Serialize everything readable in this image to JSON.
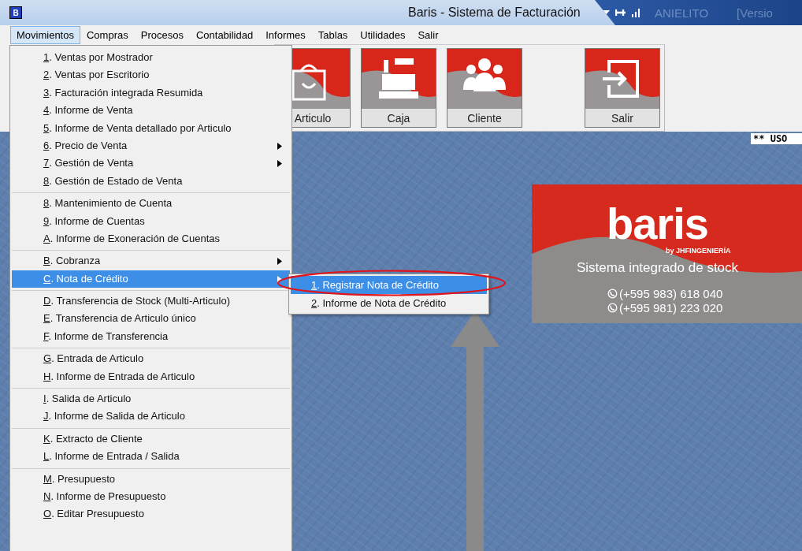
{
  "window": {
    "title": "Baris - Sistema de Facturación",
    "app_icon": "B",
    "status_texts": [
      "ANIELITO",
      "[Versio"
    ]
  },
  "menu_bar": [
    {
      "label": "Movimientos",
      "selected": true
    },
    {
      "label": "Compras",
      "selected": false
    },
    {
      "label": "Procesos",
      "selected": false
    },
    {
      "label": "Contabilidad",
      "selected": false
    },
    {
      "label": "Informes",
      "selected": false
    },
    {
      "label": "Tablas",
      "selected": false
    },
    {
      "label": "Utilidades",
      "selected": false
    },
    {
      "label": "Salir",
      "selected": false
    }
  ],
  "toolbar": [
    {
      "label": "Articulo",
      "kind": "bag"
    },
    {
      "label": "Caja",
      "kind": "register"
    },
    {
      "label": "Cliente",
      "kind": "people"
    },
    {
      "label": "Salir",
      "kind": "exit"
    }
  ],
  "desktop": {
    "notice": "** USO",
    "banner": {
      "logo": "baris",
      "byline": "by JHFINGENIERÍA",
      "tagline": "Sistema integrado de stock",
      "phones": [
        "(+595 983) 618 040",
        "(+595 981) 223 020"
      ]
    }
  },
  "dropdown": {
    "groups": [
      {
        "items": [
          {
            "label": "1. Ventas por Mostrador",
            "submenu": false,
            "selected": false
          },
          {
            "label": "2. Ventas por Escritorio",
            "submenu": false,
            "selected": false
          },
          {
            "label": "3. Facturación integrada Resumida",
            "submenu": false,
            "selected": false
          },
          {
            "label": "4. Informe de Venta",
            "submenu": false,
            "selected": false
          },
          {
            "label": "5. Informe de Venta detallado por Articulo",
            "submenu": false,
            "selected": false
          },
          {
            "label": "6. Precio de Venta",
            "submenu": true,
            "selected": false
          },
          {
            "label": "7. Gestión de Venta",
            "submenu": true,
            "selected": false
          },
          {
            "label": "8. Gestión de Estado de Venta",
            "submenu": false,
            "selected": false
          }
        ]
      },
      {
        "items": [
          {
            "label": "8. Mantenimiento de Cuenta",
            "submenu": false,
            "selected": false
          },
          {
            "label": "9. Informe de Cuentas",
            "submenu": false,
            "selected": false
          },
          {
            "label": "A. Informe de Exoneración de Cuentas",
            "submenu": false,
            "selected": false
          }
        ]
      },
      {
        "items": [
          {
            "label": "B. Cobranza",
            "submenu": true,
            "selected": false
          },
          {
            "label": "C. Nota de Crédito",
            "submenu": true,
            "selected": true
          }
        ]
      },
      {
        "items": [
          {
            "label": "D. Transferencia de Stock (Multi-Articulo)",
            "submenu": false,
            "selected": false
          },
          {
            "label": "E. Transferencia de Articulo único",
            "submenu": false,
            "selected": false
          },
          {
            "label": "F. Informe de Transferencia",
            "submenu": false,
            "selected": false
          }
        ]
      },
      {
        "items": [
          {
            "label": "G. Entrada de Articulo",
            "submenu": false,
            "selected": false
          },
          {
            "label": "H. Informe de Entrada de Articulo",
            "submenu": false,
            "selected": false
          }
        ]
      },
      {
        "items": [
          {
            "label": "I. Salida de Articulo",
            "submenu": false,
            "selected": false
          },
          {
            "label": "J. Informe de Salida de Articulo",
            "submenu": false,
            "selected": false
          }
        ]
      },
      {
        "items": [
          {
            "label": "K. Extracto de Cliente",
            "submenu": false,
            "selected": false
          },
          {
            "label": "L. Informe de Entrada / Salida",
            "submenu": false,
            "selected": false
          }
        ]
      },
      {
        "items": [
          {
            "label": "M. Presupuesto",
            "submenu": false,
            "selected": false
          },
          {
            "label": "N. Informe de Presupuesto",
            "submenu": false,
            "selected": false
          },
          {
            "label": "O. Editar Presupuesto",
            "submenu": false,
            "selected": false
          }
        ]
      }
    ]
  },
  "submenu": {
    "items": [
      {
        "label": "1. Registrar Nota de Crédito",
        "selected": true
      },
      {
        "label": "2. Informe de Nota de Crédito",
        "selected": false
      }
    ]
  }
}
